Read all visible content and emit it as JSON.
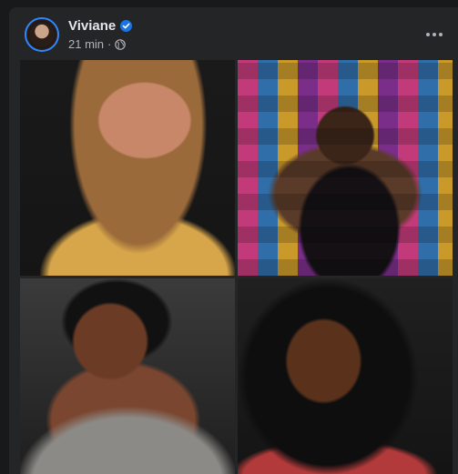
{
  "post": {
    "author": "Viviane",
    "time": "21 min",
    "separator": "·",
    "audience_icon": "globe-icon",
    "verified_icon": "verified-badge-icon",
    "more_icon": "more-options-icon"
  },
  "photos": [
    {
      "name": "post-photo-1"
    },
    {
      "name": "post-photo-2"
    },
    {
      "name": "post-photo-3"
    },
    {
      "name": "post-photo-4"
    }
  ],
  "colors": {
    "background": "#18191a",
    "card": "#242526",
    "primary_text": "#e4e6eb",
    "secondary_text": "#b0b3b8",
    "accent": "#1b74e4"
  }
}
